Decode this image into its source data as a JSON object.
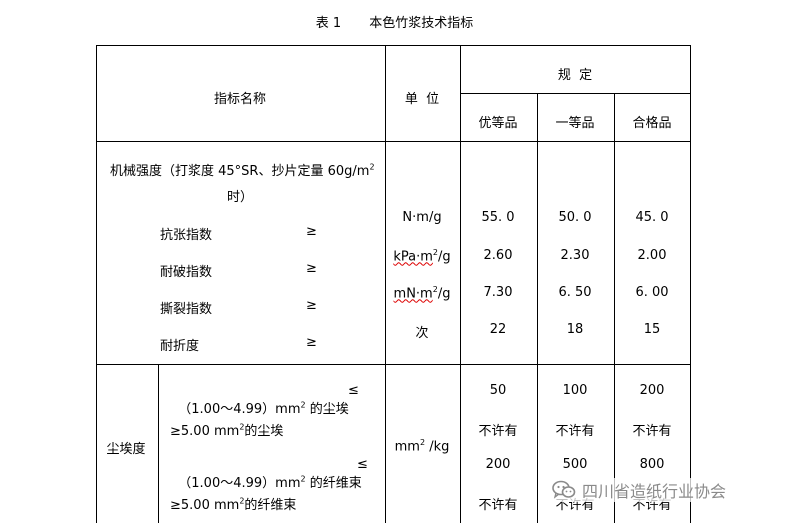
{
  "title": {
    "number": "表 1",
    "text": "本色竹浆技术指标"
  },
  "header": {
    "indicator_name": "指标名称",
    "unit": "单  位",
    "spec": "规  定",
    "grades": [
      "优等品",
      "一等品",
      "合格品"
    ]
  },
  "mechanical": {
    "label_line1": "机械强度（打浆度 45°SR、抄片定量 60g/m",
    "label_sup": "2",
    "label_line2": "时）",
    "rows": [
      {
        "name": "抗张指数",
        "op": "≥",
        "unit": "N·m/g",
        "values": [
          "55. 0",
          "50. 0",
          "45. 0"
        ]
      },
      {
        "name": "耐破指数",
        "op": "≥",
        "unit_main": "kPa·m",
        "unit_sup": "2",
        "unit_tail": "/g",
        "values": [
          "2.60",
          "2.30",
          "2.00"
        ]
      },
      {
        "name": "撕裂指数",
        "op": "≥",
        "unit_main": "mN·m",
        "unit_sup": "2",
        "unit_tail": "/g",
        "values": [
          "7.30",
          "6. 50",
          "6. 00"
        ]
      },
      {
        "name": "耐折度",
        "op": "≥",
        "unit": "次",
        "values": [
          "22",
          "18",
          "15"
        ]
      }
    ]
  },
  "dust": {
    "label": "尘埃度",
    "unit_main": "mm",
    "unit_sup": "2",
    "unit_tail": " /kg",
    "rows": [
      {
        "a": "（1.00～4.99）mm",
        "sup": "2",
        "b": " 的尘埃",
        "op": "≤",
        "values": [
          "50",
          "100",
          "200"
        ]
      },
      {
        "a": "≥5.00 mm",
        "sup": "2",
        "b": "的尘埃",
        "op": "",
        "values": [
          "不许有",
          "不许有",
          "不许有"
        ]
      },
      {
        "a": "（1.00～4.99）mm",
        "sup": "2",
        "b": " 的纤维束",
        "op": "≤",
        "values": [
          "200",
          "500",
          "800"
        ]
      },
      {
        "a": "≥5.00 mm",
        "sup": "2",
        "b": "的纤维束",
        "op": "",
        "values": [
          "不许有",
          "不许有",
          "不许有"
        ]
      }
    ]
  },
  "watermark": {
    "text": "四川省造纸行业协会",
    "icon": "wechat-icon"
  }
}
